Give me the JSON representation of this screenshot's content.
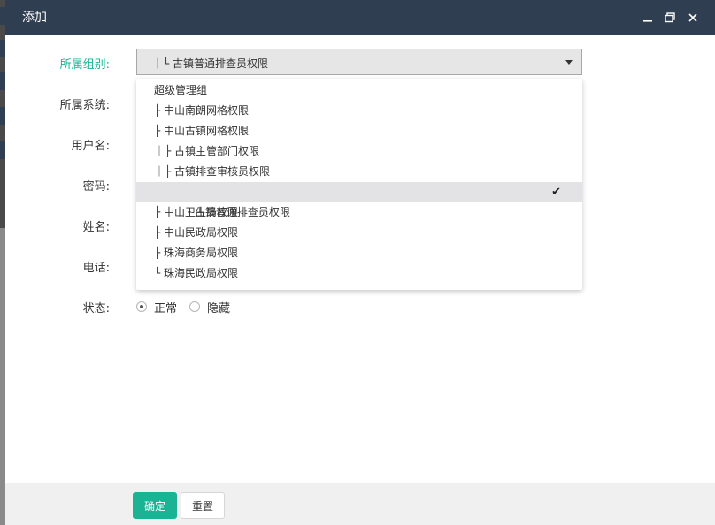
{
  "dialog": {
    "title": "添加",
    "controls": {
      "minimize_icon": "minimize-icon",
      "maximize_icon": "maximize-icon",
      "close_icon": "close-icon"
    }
  },
  "form": {
    "group_label": "所属组别:",
    "system_label": "所属系统:",
    "username_label": "用户名:",
    "password_label": "密码:",
    "name_label": "姓名:",
    "phone_label": "电话:",
    "status_label": "状态:",
    "group_select": {
      "value": "｜└ 古镇普通排查员权限"
    },
    "group_options": [
      {
        "label": "超级管理组",
        "selected": false
      },
      {
        "label": "├ 中山南朗网格权限",
        "selected": false
      },
      {
        "label": "├ 中山古镇网格权限",
        "selected": false
      },
      {
        "label": "｜├ 古镇主管部门权限",
        "selected": false
      },
      {
        "label": "｜├ 古镇排查审核员权限",
        "selected": false
      },
      {
        "label": "｜└ 古镇普通排查员权限",
        "selected": true
      },
      {
        "label": "├ 中山卫生局权限",
        "selected": false
      },
      {
        "label": "├ 中山民政局权限",
        "selected": false
      },
      {
        "label": "├ 珠海商务局权限",
        "selected": false
      },
      {
        "label": "└ 珠海民政局权限",
        "selected": false
      }
    ],
    "status_options": [
      {
        "label": "正常",
        "checked": true
      },
      {
        "label": "隐藏",
        "checked": false
      }
    ]
  },
  "footer": {
    "confirm_label": "确定",
    "reset_label": "重置"
  },
  "colors": {
    "titlebar": "#2f3e50",
    "accent": "#1ab394",
    "selected_row": "#e3e3e6"
  }
}
